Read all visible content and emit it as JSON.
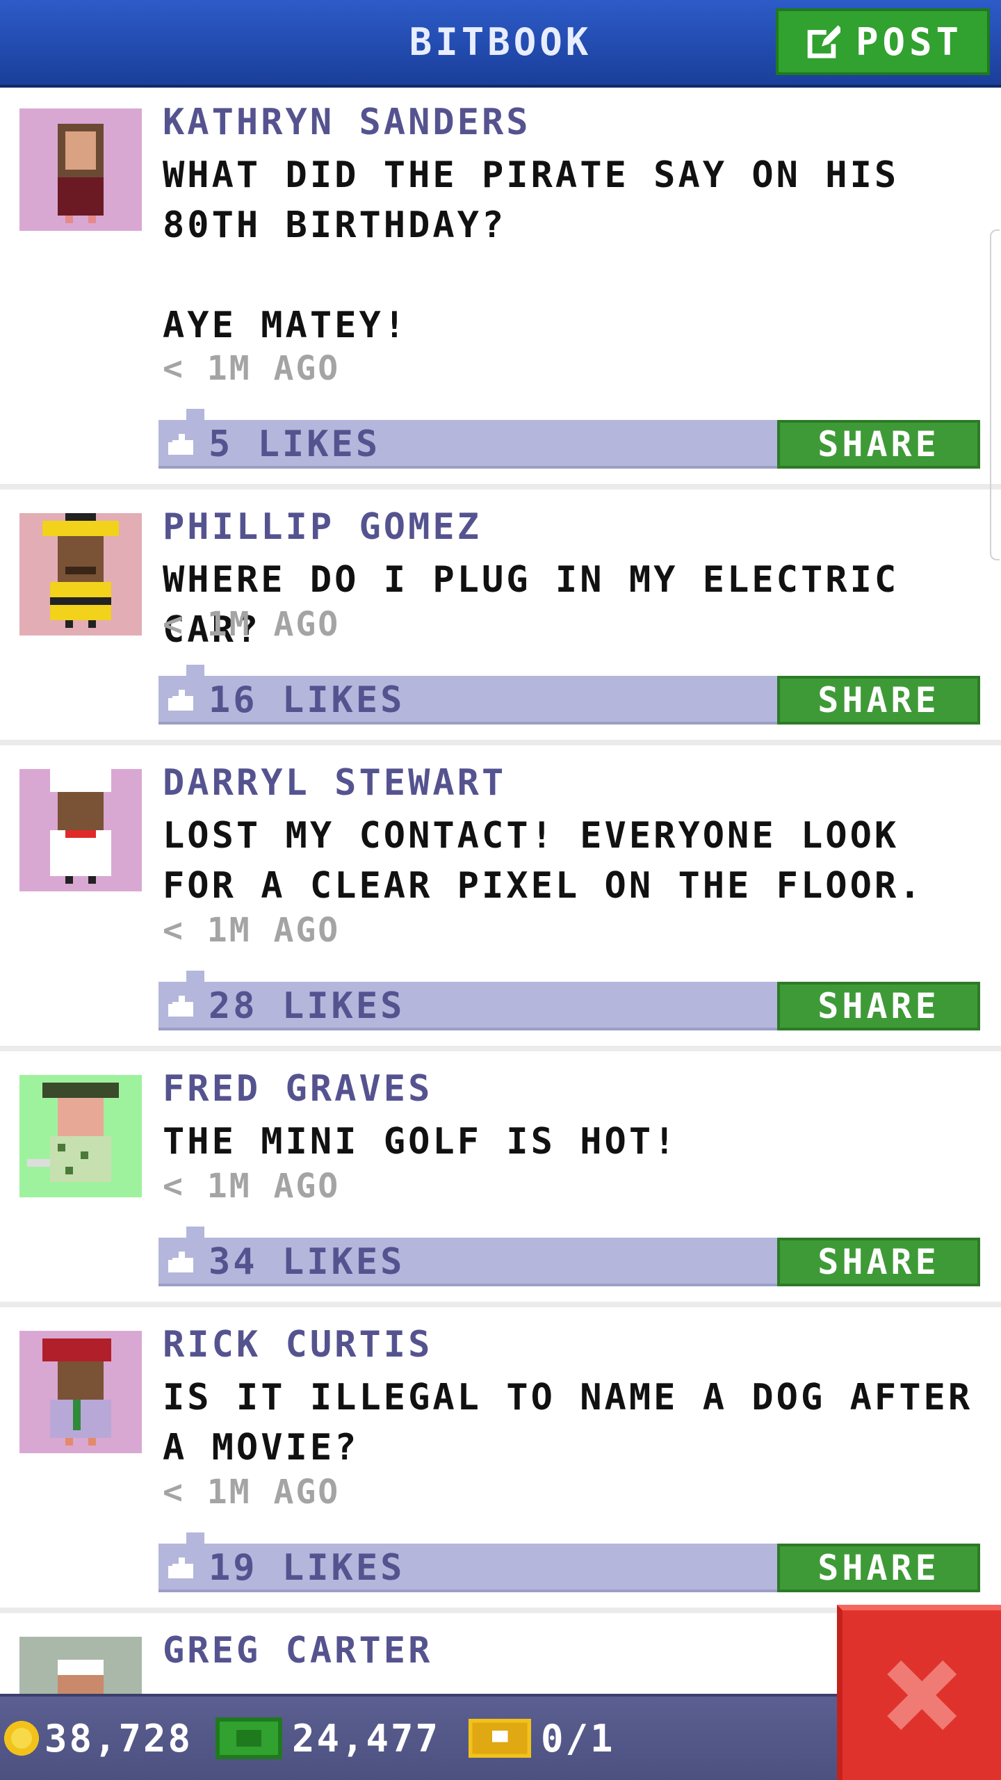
{
  "header": {
    "title": "BITBOOK",
    "post_label": "POST"
  },
  "posts": [
    {
      "author": "KATHRYN SANDERS",
      "message": "WHAT DID THE PIRATE SAY ON HIS 80TH BIRTHDAY?\n\nAYE MATEY!",
      "time": "< 1M AGO",
      "likes": "5 LIKES",
      "share_label": "SHARE",
      "avatar_bg": "#d9a8d2"
    },
    {
      "author": "PHILLIP GOMEZ",
      "message": "WHERE DO I PLUG IN MY ELECTRIC CAR?",
      "time": "< 1M AGO",
      "likes": "16 LIKES",
      "share_label": "SHARE",
      "avatar_bg": "#e2adb4"
    },
    {
      "author": "DARRYL STEWART",
      "message": "LOST MY CONTACT! EVERYONE LOOK FOR A CLEAR PIXEL ON THE FLOOR.",
      "time": "< 1M AGO",
      "likes": "28 LIKES",
      "share_label": "SHARE",
      "avatar_bg": "#d9a8d2"
    },
    {
      "author": "FRED GRAVES",
      "message": "THE MINI GOLF IS HOT!",
      "time": "< 1M AGO",
      "likes": "34 LIKES",
      "share_label": "SHARE",
      "avatar_bg": "#9ef29e"
    },
    {
      "author": "RICK CURTIS",
      "message": "IS IT ILLEGAL TO NAME A DOG AFTER A MOVIE?",
      "time": "< 1M AGO",
      "likes": "19 LIKES",
      "share_label": "SHARE",
      "avatar_bg": "#d9a8d2"
    },
    {
      "author": "GREG CARTER",
      "avatar_bg": "#a9b8a9"
    }
  ],
  "footer": {
    "coins": "38,728",
    "bux": "24,477",
    "tickets": "0/1"
  },
  "colors": {
    "header_blue": "#1f4ab3",
    "accent_green": "#3e9a36",
    "close_red": "#e0322c",
    "likes_bar": "#b4b6db",
    "author_purple": "#55538f"
  },
  "icons": [
    "edit-icon",
    "like-icon",
    "coin-icon",
    "bux-icon",
    "ticket-icon",
    "close-icon"
  ]
}
